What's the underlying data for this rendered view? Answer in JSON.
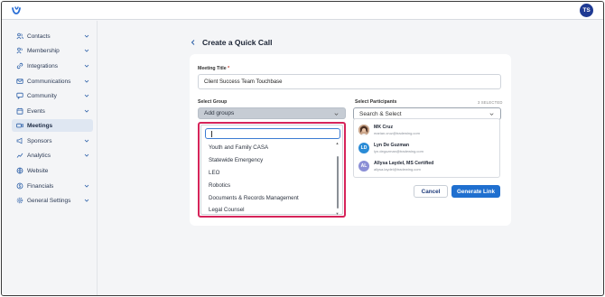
{
  "header": {
    "avatar_initials": "TS",
    "brand_color": "#1f3a93"
  },
  "sidebar": {
    "items": [
      {
        "label": "Contacts",
        "icon": "people-icon",
        "expandable": true
      },
      {
        "label": "Membership",
        "icon": "people-icon",
        "expandable": true
      },
      {
        "label": "Integrations",
        "icon": "link-icon",
        "expandable": true
      },
      {
        "label": "Communications",
        "icon": "envelope-icon",
        "expandable": true
      },
      {
        "label": "Community",
        "icon": "chat-icon",
        "expandable": true
      },
      {
        "label": "Events",
        "icon": "calendar-icon",
        "expandable": true
      },
      {
        "label": "Meetings",
        "icon": "video-icon",
        "expandable": false,
        "active": true
      },
      {
        "label": "Sponsors",
        "icon": "megaphone-icon",
        "expandable": true
      },
      {
        "label": "Analytics",
        "icon": "chart-icon",
        "expandable": true
      },
      {
        "label": "Website",
        "icon": "globe-icon",
        "expandable": false
      },
      {
        "label": "Financials",
        "icon": "dollar-icon",
        "expandable": true
      },
      {
        "label": "General Settings",
        "icon": "gear-icon",
        "expandable": true
      }
    ]
  },
  "page": {
    "title": "Create a Quick Call"
  },
  "form": {
    "meeting_title_label": "Meeting Title",
    "required_mark": "*",
    "meeting_title_value": "Client Success Team Touchbase",
    "select_group_label": "Select Group",
    "select_group_value": "Add groups",
    "select_participants_label": "Select Participants",
    "selected_count": "3 SELECTED",
    "search_select_placeholder": "Search & Select"
  },
  "dropdown": {
    "search_value": "",
    "options": [
      "Youth and Family CASA",
      "Statewide Emergency",
      "LEO",
      "Robotics",
      "Documents & Records Management",
      "Legal Counsel"
    ]
  },
  "participants": [
    {
      "name": "MK Cruz",
      "email": "marian.cruz@tradewing.com",
      "initials": "",
      "avatar_color": "#7a5a44",
      "has_photo": true
    },
    {
      "name": "Lyn De Guzman",
      "email": "lyn.deguzman@tradewing.com",
      "initials": "LD",
      "avatar_color": "#2a8bd6",
      "has_photo": false
    },
    {
      "name": "Allysa Laydel, MS Certified",
      "email": "allysa.laydel@tradewing.com",
      "initials": "AL",
      "avatar_color": "#8b8fd6",
      "has_photo": false
    }
  ],
  "actions": {
    "cancel_label": "Cancel",
    "generate_label": "Generate Link",
    "primary_color": "#1f6fcf",
    "highlight_color": "#d6245a"
  }
}
